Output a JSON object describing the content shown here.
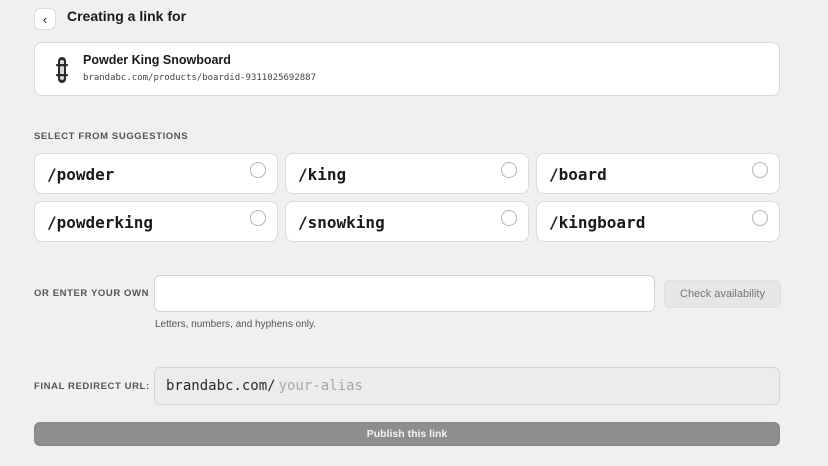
{
  "header": {
    "back_icon": "chevron-left-icon",
    "title": "Creating a link for"
  },
  "product": {
    "icon": "snowboard-icon",
    "name": "Powder King Snowboard",
    "url": "brandabc.com/products/boardid-9311025692887"
  },
  "suggestions": {
    "label": "SELECT FROM SUGGESTIONS",
    "items": [
      "/powder",
      "/king",
      "/board",
      "/powderking",
      "/snowking",
      "/kingboard"
    ]
  },
  "custom": {
    "label": "OR ENTER YOUR OWN",
    "value": "",
    "placeholder": "",
    "check_label": "Check availability",
    "hint": "Letters, numbers, and hyphens only."
  },
  "redirect": {
    "label": "FINAL REDIRECT URL:",
    "domain": "brandabc.com/",
    "alias_placeholder": "your-alias"
  },
  "publish": {
    "label": "Publish this link"
  },
  "colors": {
    "background": "#f0f0f0",
    "card": "#ffffff",
    "publish_disabled": "#8e8e8e"
  }
}
